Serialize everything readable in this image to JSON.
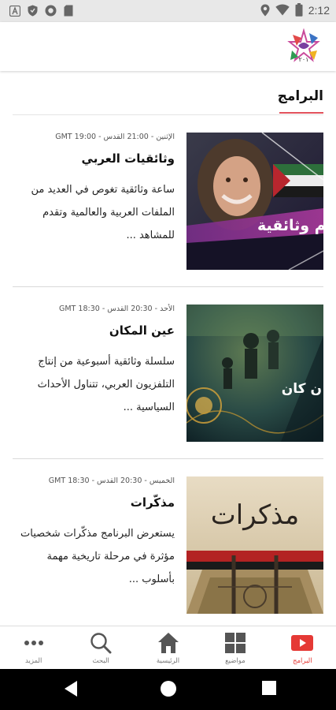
{
  "status_bar": {
    "time": "2:12",
    "left_icons": [
      "font-a-icon",
      "shield-icon",
      "record-icon",
      "sd-card-icon"
    ],
    "right_icons": [
      "location-icon",
      "wifi-icon",
      "battery-icon"
    ]
  },
  "header": {
    "logo_icon": "channel-logo-icon"
  },
  "section": {
    "title": "البرامج",
    "accent_color": "#e2525c"
  },
  "programs": [
    {
      "time": "الإثنين - 21:00 القدس - 19:00 GMT",
      "name": "وثائقيات العربي",
      "description": "ساعة وثائقية تغوص في العديد من الملفات العربية والعالمية وتقدم للمشاهد ...",
      "thumb_text": "أفلام وثائقية"
    },
    {
      "time": "الأحد - 20:30 القدس - 18:30 GMT",
      "name": "عين المكان",
      "description": "سلسلة وثائقية أسبوعية من إنتاج التلفزيون العربي، تتناول الأحداث السياسية ...",
      "thumb_text": "ن\nكان"
    },
    {
      "time": "الخميس - 20:30 القدس - 18:30 GMT",
      "name": "مذكّرات",
      "description": "يستعرض البرنامج مذكّرات شخصيات مؤثرة في مرحلة تاريخية مهمة بأسلوب ...",
      "thumb_text": "مذكرات"
    }
  ],
  "bottom_nav": {
    "active_color": "#e53935",
    "items": [
      {
        "label": "المزيد",
        "icon": "more-dots-icon"
      },
      {
        "label": "البحث",
        "icon": "search-icon"
      },
      {
        "label": "الرئيسية",
        "icon": "home-icon"
      },
      {
        "label": "مواضيع",
        "icon": "grid-icon"
      },
      {
        "label": "البرامج",
        "icon": "play-icon"
      }
    ]
  },
  "system_nav": {
    "icons": [
      "back-icon",
      "home-circle-icon",
      "recents-icon"
    ]
  }
}
